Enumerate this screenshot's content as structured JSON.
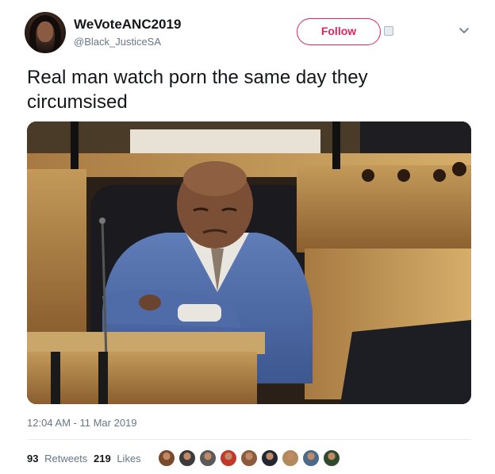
{
  "user": {
    "name": "WeVoteANC2019",
    "handle": "@Black_JusticeSA"
  },
  "follow_label": "Follow",
  "tweet": {
    "line1": "Real man watch porn the same day they",
    "line2": "circumsised"
  },
  "timestamp": "12:04 AM - 11 Mar 2019",
  "stats": {
    "retweets_count": "93",
    "retweets_label": "Retweets",
    "likes_count": "219",
    "likes_label": "Likes"
  },
  "colors": {
    "accent": "#e0245e",
    "secondary_text": "#657786",
    "divider": "#e6ecf0"
  },
  "likers": [
    {
      "name": "liker-avatar-1",
      "color": "#7a4a2e"
    },
    {
      "name": "liker-avatar-2",
      "color": "#3b3b3b"
    },
    {
      "name": "liker-avatar-3",
      "color": "#5a5a5a"
    },
    {
      "name": "liker-avatar-4",
      "color": "#c0392b"
    },
    {
      "name": "liker-avatar-5",
      "color": "#8d5b3c"
    },
    {
      "name": "liker-avatar-6",
      "color": "#222831"
    },
    {
      "name": "liker-avatar-7",
      "color": "#b08a5a"
    },
    {
      "name": "liker-avatar-8",
      "color": "#4a6a8a"
    },
    {
      "name": "liker-avatar-9",
      "color": "#2e4a2e"
    }
  ]
}
